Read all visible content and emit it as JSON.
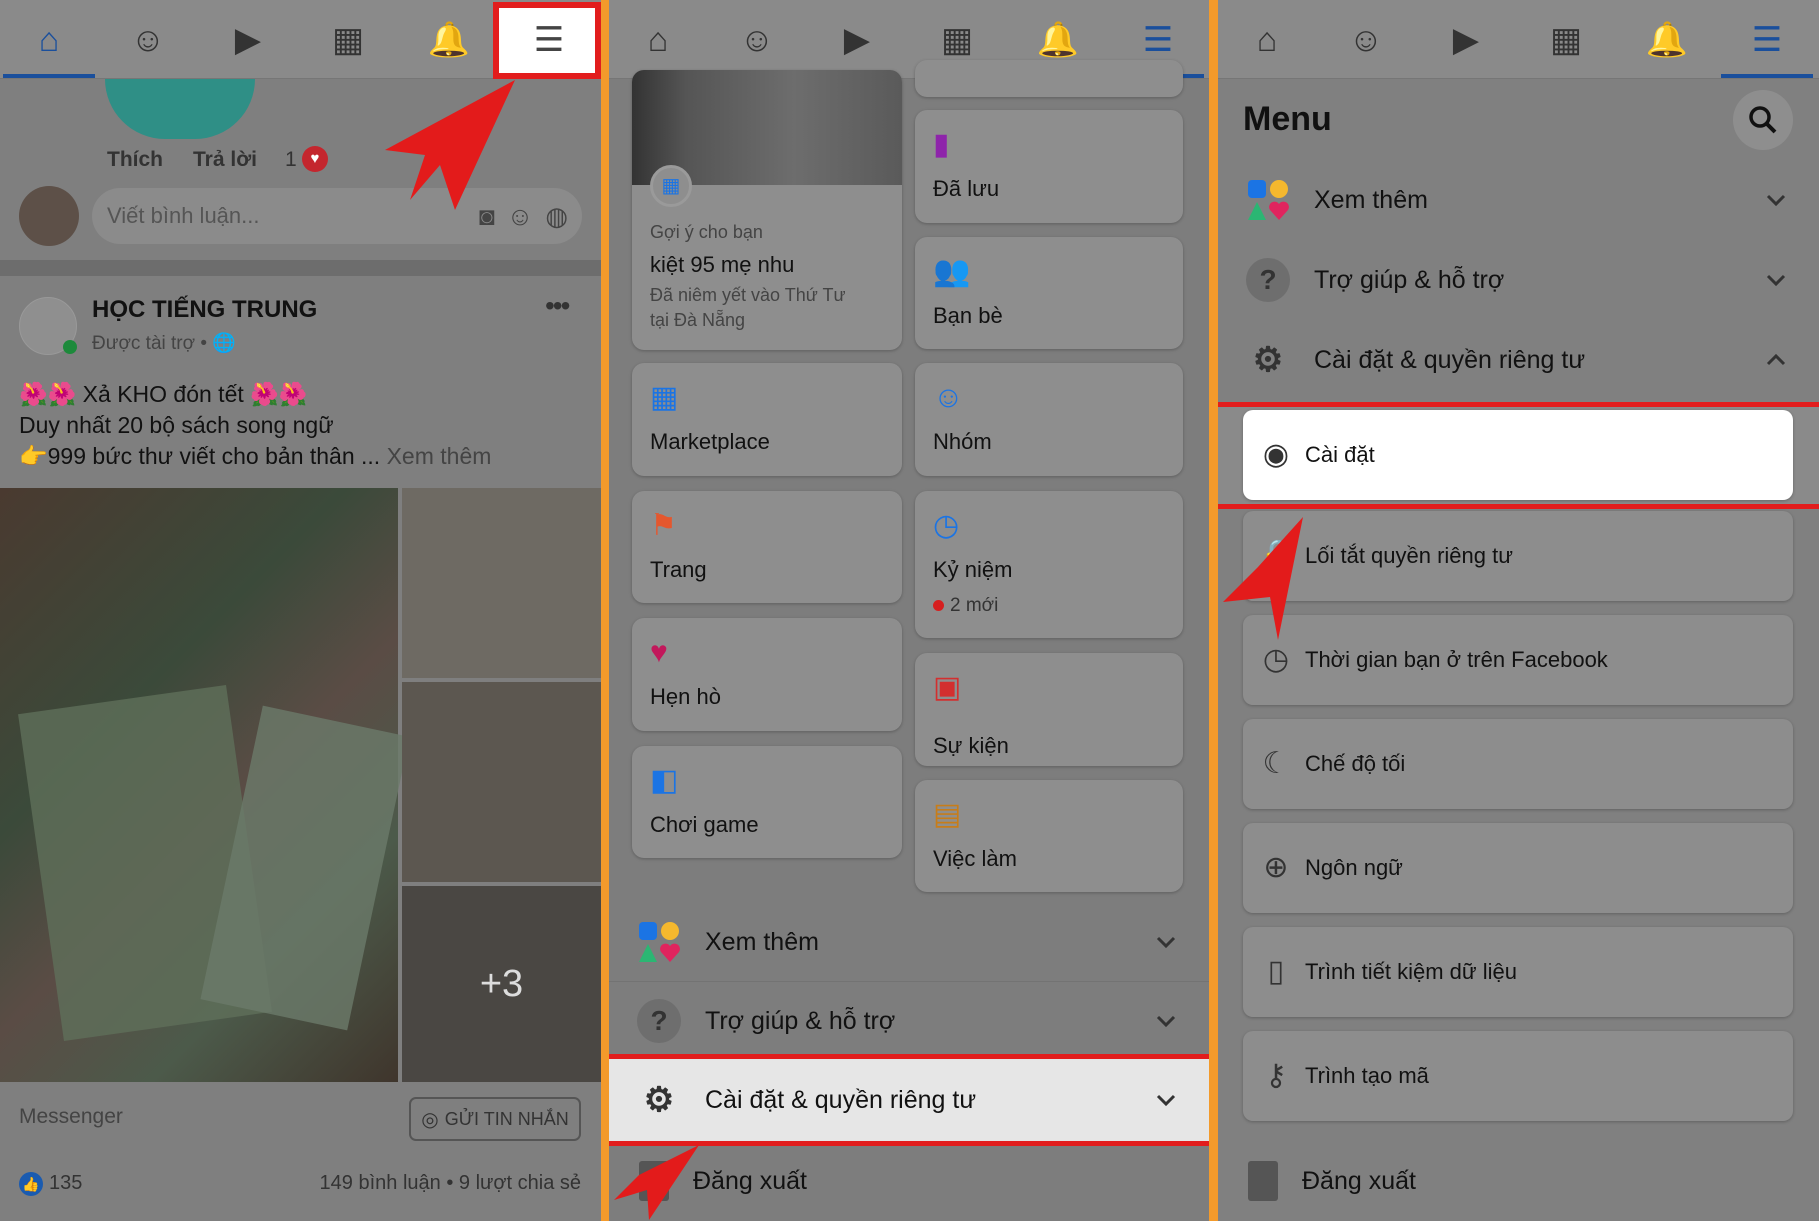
{
  "colors": {
    "accent": "#1877f2",
    "highlight": "#e21d1d",
    "divider": "#f39a2b"
  },
  "nav_icons": [
    "home-icon",
    "groups-icon",
    "watch-icon",
    "marketplace-icon",
    "notifications-icon",
    "menu-icon"
  ],
  "panel1": {
    "reactions": {
      "like": "Thích",
      "reply": "Trả lời",
      "count": "1"
    },
    "comment_placeholder": "Viết bình luận...",
    "post": {
      "page_name": "HỌC TIẾNG TRUNG",
      "sponsored": "Được tài trợ •",
      "lines": [
        "🌺🌺 Xả KHO đón tết 🌺🌺",
        "Duy nhất 20 bộ sách song ngữ",
        "👉999 bức thư viết cho bản thân ..."
      ],
      "see_more": "Xem thêm",
      "more_photos": "+3",
      "messenger_label": "Messenger",
      "send_button": "GỬI TIN NHẮN",
      "likes": "135",
      "stats": "149 bình luận • 9 lượt chia sẻ"
    }
  },
  "panel2": {
    "suggestion": {
      "caption": "Gợi ý cho bạn",
      "title": "kiệt 95 mẹ nhu",
      "sub1": "Đã niêm yết vào Thứ Tư",
      "sub2": "tại Đà Nẵng"
    },
    "left_cards": [
      {
        "label": "Marketplace",
        "icon": "marketplace-icon",
        "color": "#1b74e4"
      },
      {
        "label": "Trang",
        "icon": "flag-icon",
        "color": "#e4572e"
      },
      {
        "label": "Hẹn hò",
        "icon": "heart-icon",
        "color": "#c2185b"
      },
      {
        "label": "Chơi game",
        "icon": "gaming-icon",
        "color": "#1b74e4"
      }
    ],
    "right_cards": [
      {
        "label": "Đã lưu",
        "icon": "bookmark-icon",
        "color": "#8e24aa"
      },
      {
        "label": "Bạn bè",
        "icon": "friends-icon",
        "color": "#1b74e4"
      },
      {
        "label": "Nhóm",
        "icon": "groups-icon",
        "color": "#1b74e4"
      },
      {
        "label": "Kỷ niệm",
        "icon": "memories-icon",
        "color": "#1b74e4",
        "badge": "2 mới"
      },
      {
        "label": "Sự kiện",
        "icon": "calendar-icon",
        "color": "#d32f2f"
      },
      {
        "label": "Việc làm",
        "icon": "briefcase-icon",
        "color": "#c77d1a"
      }
    ],
    "sections": [
      {
        "label": "Xem thêm",
        "icon": "shapes-icon"
      },
      {
        "label": "Trợ giúp & hỗ trợ",
        "icon": "help-icon"
      },
      {
        "label": "Cài đặt & quyền riêng tư",
        "icon": "gear-icon"
      }
    ],
    "logout": "Đăng xuất"
  },
  "panel3": {
    "title": "Menu",
    "sections": [
      {
        "label": "Xem thêm",
        "icon": "shapes-icon",
        "expanded": false
      },
      {
        "label": "Trợ giúp & hỗ trợ",
        "icon": "help-icon",
        "expanded": false
      },
      {
        "label": "Cài đặt & quyền riêng tư",
        "icon": "gear-icon",
        "expanded": true
      }
    ],
    "items": [
      {
        "label": "Cài đặt",
        "icon": "user-circle-icon"
      },
      {
        "label": "Lối tắt quyền riêng tư",
        "icon": "lock-icon"
      },
      {
        "label": "Thời gian bạn ở trên Facebook",
        "icon": "clock-icon"
      },
      {
        "label": "Chế độ tối",
        "icon": "moon-icon"
      },
      {
        "label": "Ngôn ngữ",
        "icon": "globe-icon"
      },
      {
        "label": "Trình tiết kiệm dữ liệu",
        "icon": "phone-icon"
      },
      {
        "label": "Trình tạo mã",
        "icon": "key-icon"
      }
    ],
    "logout": "Đăng xuất"
  }
}
